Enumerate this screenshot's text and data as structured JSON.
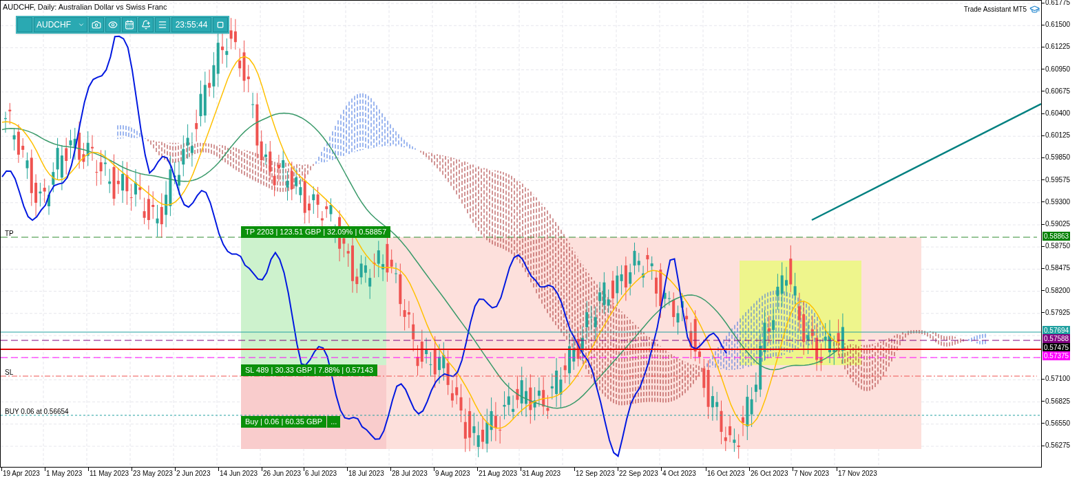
{
  "chart": {
    "title": "AUDCHF, Daily: Australian Dollar vs Swiss Franc",
    "panel_title": "Trade Assistant MT5"
  },
  "toolbar": {
    "symbol": "AUDCHF",
    "time": "23:55:44"
  },
  "price_axis": [
    "0.61775",
    "0.61500",
    "0.61225",
    "0.60950",
    "0.60675",
    "0.60400",
    "0.60125",
    "0.59850",
    "0.59575",
    "0.59300",
    "0.59025",
    "0.58750",
    "0.58475",
    "0.58200",
    "0.57925",
    "0.57100",
    "0.56825",
    "0.56550",
    "0.56275"
  ],
  "price_markers": [
    {
      "text": "0.58863",
      "color": "#008000"
    },
    {
      "text": "0.57694",
      "color": "#20a0a0"
    },
    {
      "text": "0.57588",
      "color": "#800080"
    },
    {
      "text": "0.57475",
      "color": "#000000"
    },
    {
      "text": "0.57375",
      "color": "#ff00ff"
    }
  ],
  "date_axis": [
    "19 Apr 2023",
    "1 May 2023",
    "11 May 2023",
    "23 May 2023",
    "2 Jun 2023",
    "14 Jun 2023",
    "26 Jun 2023",
    "6 Jul 2023",
    "18 Jul 2023",
    "28 Jul 2023",
    "9 Aug 2023",
    "21 Aug 2023",
    "31 Aug 2023",
    "12 Sep 2023",
    "22 Sep 2023",
    "4 Oct 2023",
    "16 Oct 2023",
    "26 Oct 2023",
    "7 Nov 2023",
    "17 Nov 2023"
  ],
  "line_labels": [
    "TP",
    "SL",
    "BUY 0.06 at 0.56654"
  ],
  "trade": {
    "take_profit": "TP 2203 | 123.51 GBP | 32.09% | 0.58857",
    "stop_loss": "SL 489 | 30.33 GBP | 7.88% | 0.57143",
    "order": "Buy | 0.06 | 60.35 GBP",
    "more": "..."
  }
}
